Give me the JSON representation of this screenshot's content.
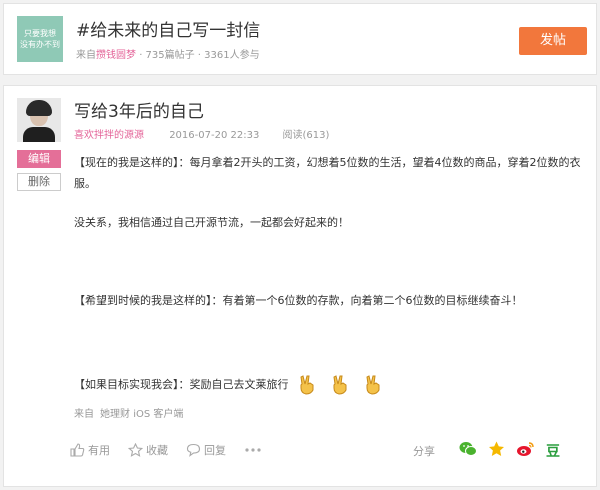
{
  "topic": {
    "thumb_line1": "只要我想",
    "thumb_line2": "没有办不到",
    "title": "#给未来的自己写一封信",
    "from_label": "来自",
    "author": "攒钱圆梦",
    "stats": "· 735篇帖子 · 3361人参与",
    "post_button": "发帖"
  },
  "post": {
    "title": "写给3年后的自己",
    "author": "喜欢拌拌的源源",
    "date": "2016-07-20 22:33",
    "reads": "阅读(613)",
    "edit_label": "编辑",
    "delete_label": "删除",
    "paragraphs": [
      "【现在的我是这样的】：每月拿着2开头的工资，幻想着5位数的生活，望着4位数的商品，穿着2位数的衣服。",
      "没关系，我相信通过自己开源节流，一起都会好起来的！",
      "【希望到时候的我是这样的】：有着第一个6位数的存款，向着第二个6位数的目标继续奋斗！",
      "【如果目标实现我会】：奖励自己去文莱旅行"
    ],
    "source_label": "来自",
    "source_app": "她理财",
    "source_client": "iOS 客户端"
  },
  "actions": {
    "like": "有用",
    "favorite": "收藏",
    "reply": "回复",
    "share": "分享"
  },
  "colors": {
    "accent_pink": "#e46f98",
    "post_button": "#f2773c",
    "thumb_bg": "#8fc9b6"
  }
}
